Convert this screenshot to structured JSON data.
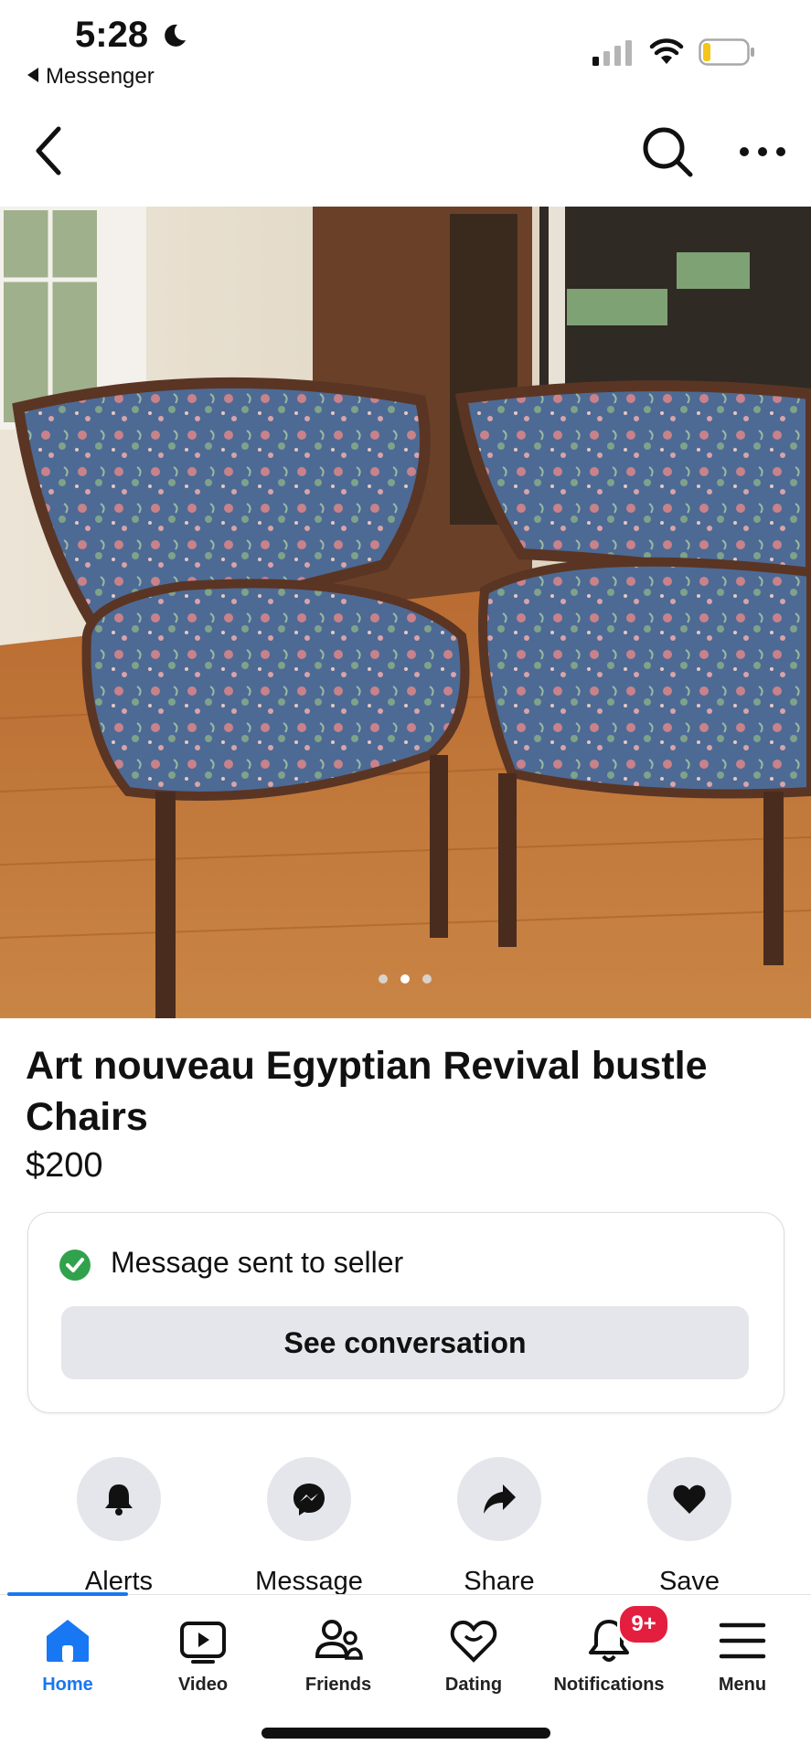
{
  "status_bar": {
    "time": "5:28",
    "back_app": "Messenger"
  },
  "listing": {
    "title": "Art nouveau Egyptian Revival bustle Chairs",
    "price": "$200",
    "photo_count": 3,
    "photo_active_index": 2
  },
  "message_card": {
    "status_text": "Message sent to seller",
    "button_label": "See conversation",
    "status_color": "#31a24c"
  },
  "actions": [
    {
      "label": "Alerts",
      "icon": "bell-icon"
    },
    {
      "label": "Message",
      "icon": "messenger-icon"
    },
    {
      "label": "Share",
      "icon": "share-arrow-icon"
    },
    {
      "label": "Save",
      "icon": "heart-icon"
    }
  ],
  "tabs": [
    {
      "label": "Home",
      "icon": "home-icon",
      "active": true
    },
    {
      "label": "Video",
      "icon": "video-icon"
    },
    {
      "label": "Friends",
      "icon": "friends-icon"
    },
    {
      "label": "Dating",
      "icon": "dating-icon"
    },
    {
      "label": "Notifications",
      "icon": "bell-icon",
      "badge": "9+"
    },
    {
      "label": "Menu",
      "icon": "menu-icon"
    }
  ],
  "colors": {
    "accent": "#1877f2",
    "badge": "#e41e3f",
    "button_bg": "#e4e6eb"
  }
}
